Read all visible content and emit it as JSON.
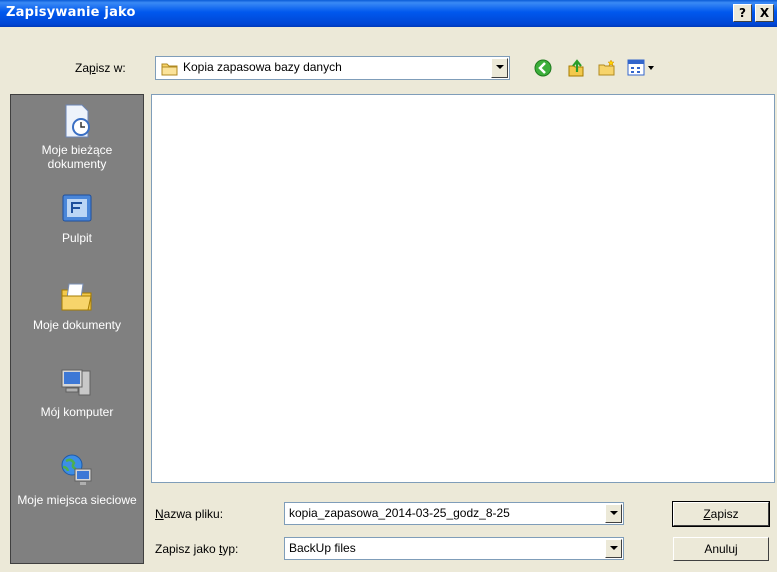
{
  "window": {
    "title": "Zapisywanie jako",
    "help_button": "?",
    "close_button": "X"
  },
  "save_in": {
    "label_pre": "Za",
    "label_key": "p",
    "label_post": "isz w:",
    "folder": "Kopia zapasowa bazy danych"
  },
  "places": [
    {
      "label": "Moje bieżące dokumenty",
      "icon": "recent-documents-icon"
    },
    {
      "label": "Pulpit",
      "icon": "desktop-icon"
    },
    {
      "label": "Moje dokumenty",
      "icon": "my-documents-icon"
    },
    {
      "label": "Mój komputer",
      "icon": "my-computer-icon"
    },
    {
      "label": "Moje miejsca sieciowe",
      "icon": "network-places-icon"
    }
  ],
  "filename": {
    "label_key": "N",
    "label_post": "azwa pliku:",
    "value": "kopia_zapasowa_2014-03-25_godz_8-25"
  },
  "filetype": {
    "label_pre": "Zapisz jako ",
    "label_key": "t",
    "label_post": "yp:",
    "value": "BackUp files"
  },
  "buttons": {
    "save_key": "Z",
    "save_rest": "apisz",
    "cancel": "Anuluj"
  }
}
